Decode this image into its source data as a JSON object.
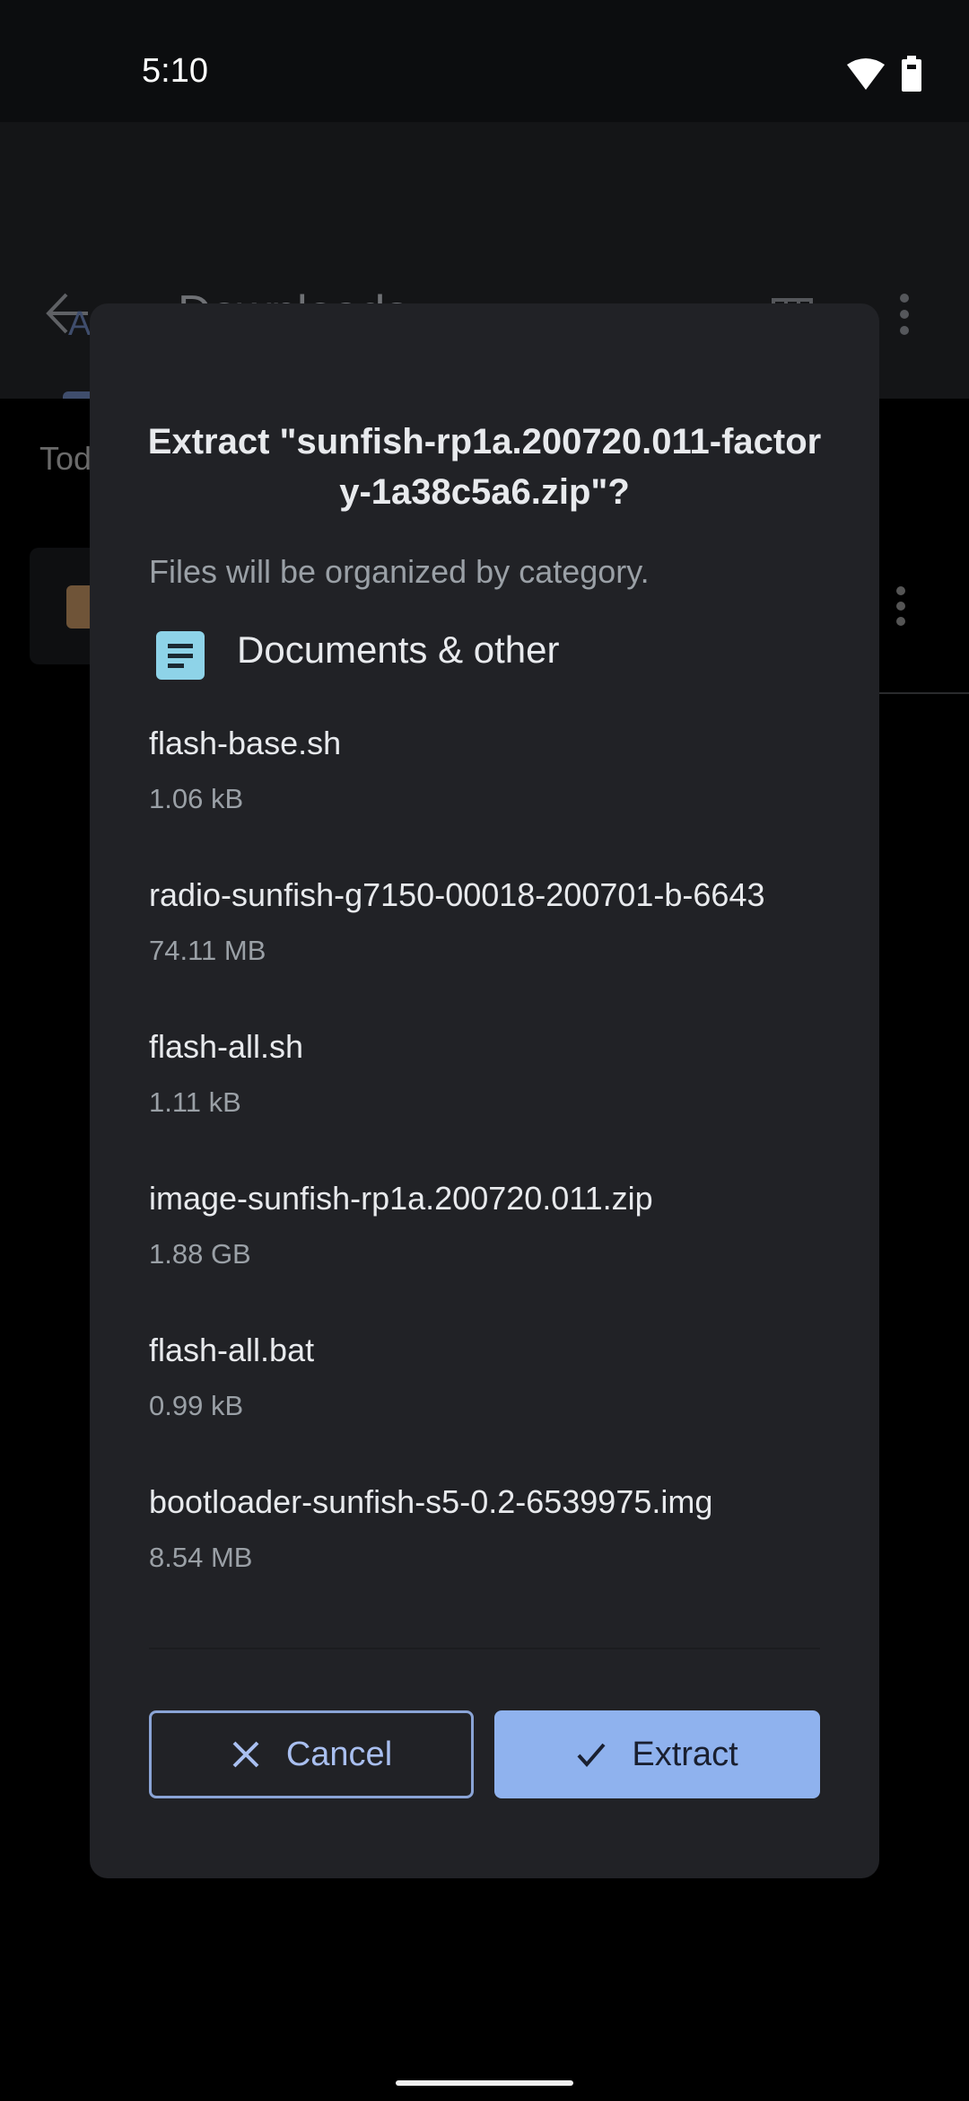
{
  "status_bar": {
    "time": "5:10",
    "icons": [
      "wifi-icon",
      "battery-icon"
    ]
  },
  "app_bar": {
    "title": "Downloads",
    "back_icon": "arrow-back-icon",
    "view_icon": "grid-view-icon",
    "more_icon": "more-vert-icon"
  },
  "background": {
    "tab_partial": "A",
    "section_partial": "Tod"
  },
  "dialog": {
    "title": "Extract \"sunfish-rp1a.200720.011-factory-1a38c5a6.zip\"?",
    "subtitle": "Files will be organized by category.",
    "category": {
      "icon": "document-icon",
      "label": "Documents & other",
      "icon_color": "#8ed3e8"
    },
    "files": [
      {
        "name": "flash-base.sh",
        "size": "1.06 kB"
      },
      {
        "name": "radio-sunfish-g7150-00018-200701-b-6643",
        "size": "74.11 MB"
      },
      {
        "name": "flash-all.sh",
        "size": "1.11 kB"
      },
      {
        "name": "image-sunfish-rp1a.200720.011.zip",
        "size": "1.88 GB"
      },
      {
        "name": "flash-all.bat",
        "size": "0.99 kB"
      },
      {
        "name": "bootloader-sunfish-s5-0.2-6539975.img",
        "size": "8.54 MB"
      }
    ],
    "cancel_label": "Cancel",
    "extract_label": "Extract",
    "accent_color": "#8fb2ee"
  }
}
